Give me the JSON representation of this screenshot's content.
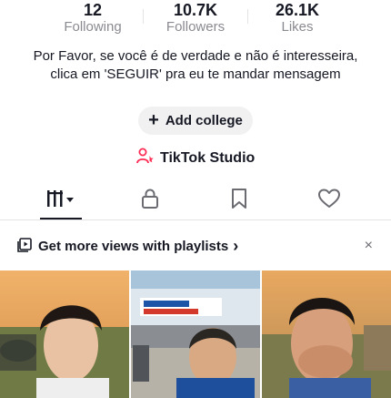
{
  "profile": {
    "stats": [
      {
        "value": "12",
        "label": "Following"
      },
      {
        "value": "10.7K",
        "label": "Followers"
      },
      {
        "value": "26.1K",
        "label": "Likes"
      }
    ],
    "bio": "Por Favor, se você é de verdade e não é interesseira, clica em 'SEGUIR' pra eu te mandar mensagem",
    "add_college_label": "Add college",
    "studio_label": "TikTok Studio"
  },
  "tabs": [
    {
      "name": "videos-grid",
      "icon": "grid-dropdown-icon",
      "active": true
    },
    {
      "name": "private",
      "icon": "lock-icon",
      "active": false
    },
    {
      "name": "saved",
      "icon": "bookmark-icon",
      "active": false
    },
    {
      "name": "liked",
      "icon": "heart-icon",
      "active": false
    }
  ],
  "banner": {
    "text": "Get more views with playlists",
    "chevron": "›",
    "close": "×"
  },
  "colors": {
    "text": "#161823",
    "secondary": "#8a8b91",
    "accent_pink": "#fe2c55",
    "chip_bg": "#f1f1f2"
  }
}
